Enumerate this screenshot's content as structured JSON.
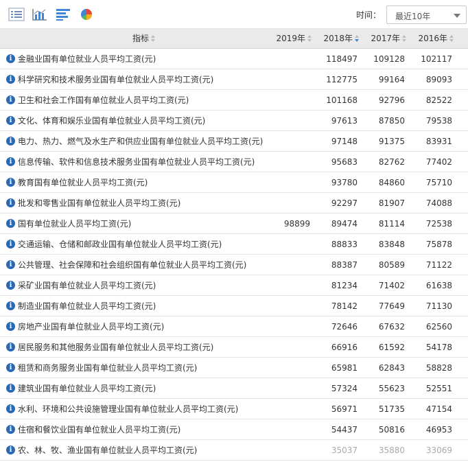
{
  "toolbar": {
    "icons": [
      "table-view-icon",
      "bar-chart-icon",
      "horizontal-bar-chart-icon",
      "pie-chart-icon"
    ],
    "time_label": "时间：",
    "time_value": "最近10年"
  },
  "table": {
    "columns": [
      "指标",
      "2019年",
      "2018年",
      "2017年",
      "2016年"
    ],
    "rows": [
      {
        "name": "金融业国有单位就业人员平均工资(元)",
        "v2019": "",
        "v2018": "118497",
        "v2017": "109128",
        "v2016": "102117"
      },
      {
        "name": "科学研究和技术服务业国有单位就业人员平均工资(元)",
        "v2019": "",
        "v2018": "112775",
        "v2017": "99164",
        "v2016": "89093"
      },
      {
        "name": "卫生和社会工作国有单位就业人员平均工资(元)",
        "v2019": "",
        "v2018": "101168",
        "v2017": "92796",
        "v2016": "82522"
      },
      {
        "name": "文化、体育和娱乐业国有单位就业人员平均工资(元)",
        "v2019": "",
        "v2018": "97613",
        "v2017": "87850",
        "v2016": "79538"
      },
      {
        "name": "电力、热力、燃气及水生产和供应业国有单位就业人员平均工资(元)",
        "v2019": "",
        "v2018": "97148",
        "v2017": "91375",
        "v2016": "83931"
      },
      {
        "name": "信息传输、软件和信息技术服务业国有单位就业人员平均工资(元)",
        "v2019": "",
        "v2018": "95683",
        "v2017": "82762",
        "v2016": "77402"
      },
      {
        "name": "教育国有单位就业人员平均工资(元)",
        "v2019": "",
        "v2018": "93780",
        "v2017": "84860",
        "v2016": "75710"
      },
      {
        "name": "批发和零售业国有单位就业人员平均工资(元)",
        "v2019": "",
        "v2018": "92297",
        "v2017": "81907",
        "v2016": "74088"
      },
      {
        "name": "国有单位就业人员平均工资(元)",
        "v2019": "98899",
        "v2018": "89474",
        "v2017": "81114",
        "v2016": "72538"
      },
      {
        "name": "交通运输、仓储和邮政业国有单位就业人员平均工资(元)",
        "v2019": "",
        "v2018": "88833",
        "v2017": "83848",
        "v2016": "75878"
      },
      {
        "name": "公共管理、社会保障和社会组织国有单位就业人员平均工资(元)",
        "v2019": "",
        "v2018": "88387",
        "v2017": "80589",
        "v2016": "71122"
      },
      {
        "name": "采矿业国有单位就业人员平均工资(元)",
        "v2019": "",
        "v2018": "81234",
        "v2017": "71402",
        "v2016": "61638"
      },
      {
        "name": "制造业国有单位就业人员平均工资(元)",
        "v2019": "",
        "v2018": "78142",
        "v2017": "77649",
        "v2016": "71130"
      },
      {
        "name": "房地产业国有单位就业人员平均工资(元)",
        "v2019": "",
        "v2018": "72646",
        "v2017": "67632",
        "v2016": "62560"
      },
      {
        "name": "居民服务和其他服务业国有单位就业人员平均工资(元)",
        "v2019": "",
        "v2018": "66916",
        "v2017": "61592",
        "v2016": "54178"
      },
      {
        "name": "租赁和商务服务业国有单位就业人员平均工资(元)",
        "v2019": "",
        "v2018": "65981",
        "v2017": "62843",
        "v2016": "58828"
      },
      {
        "name": "建筑业国有单位就业人员平均工资(元)",
        "v2019": "",
        "v2018": "57324",
        "v2017": "55623",
        "v2016": "52551"
      },
      {
        "name": "水利、环境和公共设施管理业国有单位就业人员平均工资(元)",
        "v2019": "",
        "v2018": "56971",
        "v2017": "51735",
        "v2016": "47154"
      },
      {
        "name": "住宿和餐饮业国有单位就业人员平均工资(元)",
        "v2019": "",
        "v2018": "54437",
        "v2017": "50816",
        "v2016": "46953"
      },
      {
        "name": "农、林、牧、渔业国有单位就业人员平均工资(元)",
        "v2019": "",
        "v2018": "35037",
        "v2017": "35880",
        "v2016": "33069"
      }
    ]
  }
}
